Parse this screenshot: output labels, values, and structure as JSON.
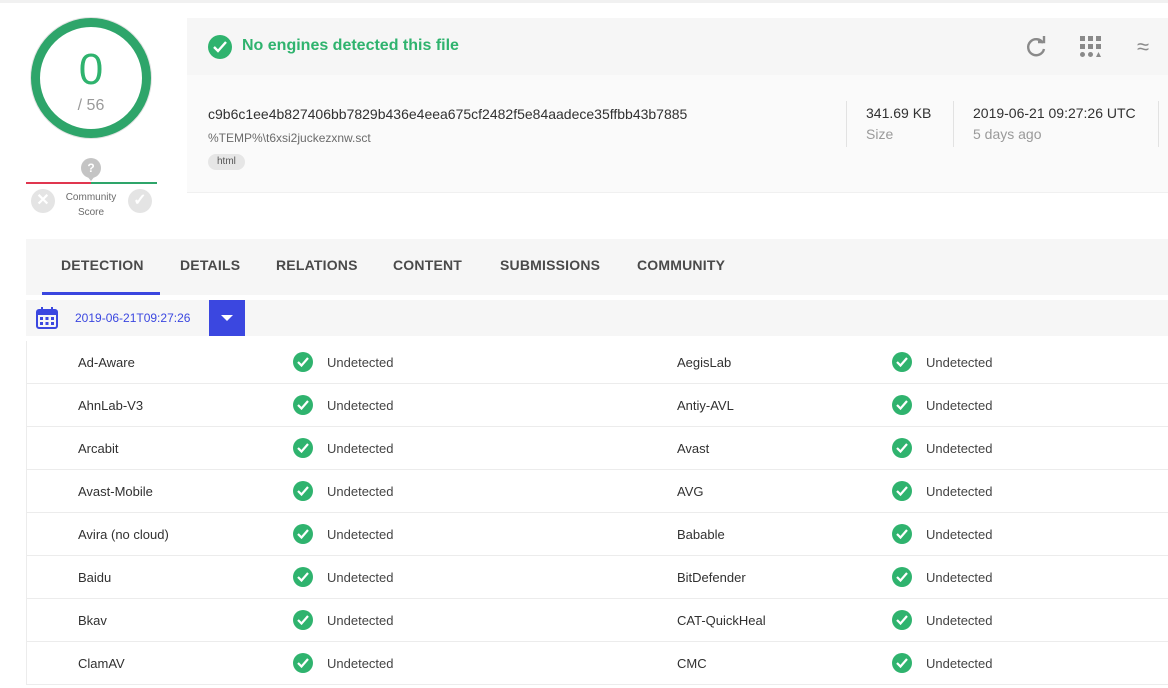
{
  "score": {
    "detections": "0",
    "total": "/ 56"
  },
  "community": {
    "marker": "?",
    "label_line1": "Community",
    "label_line2": "Score"
  },
  "summary": {
    "status_text": "No engines detected this file",
    "hash": "c9b6c1ee4b827406bb7829b436e4eea675cf2482f5e84aadece35ffbb43b7885",
    "filename": "%TEMP%\\t6xsi2juckezxnw.sct",
    "tag": "html",
    "size_value": "341.69 KB",
    "size_label": "Size",
    "date_value": "2019-06-21 09:27:26 UTC",
    "date_ago": "5 days ago",
    "wave_glyph": "≈"
  },
  "tabs": [
    "DETECTION",
    "DETAILS",
    "RELATIONS",
    "CONTENT",
    "SUBMISSIONS",
    "COMMUNITY"
  ],
  "analysis_date": "2019-06-21T09:27:26",
  "results": [
    {
      "a_engine": "Ad-Aware",
      "a_result": "Undetected",
      "b_engine": "AegisLab",
      "b_result": "Undetected"
    },
    {
      "a_engine": "AhnLab-V3",
      "a_result": "Undetected",
      "b_engine": "Antiy-AVL",
      "b_result": "Undetected"
    },
    {
      "a_engine": "Arcabit",
      "a_result": "Undetected",
      "b_engine": "Avast",
      "b_result": "Undetected"
    },
    {
      "a_engine": "Avast-Mobile",
      "a_result": "Undetected",
      "b_engine": "AVG",
      "b_result": "Undetected"
    },
    {
      "a_engine": "Avira (no cloud)",
      "a_result": "Undetected",
      "b_engine": "Babable",
      "b_result": "Undetected"
    },
    {
      "a_engine": "Baidu",
      "a_result": "Undetected",
      "b_engine": "BitDefender",
      "b_result": "Undetected"
    },
    {
      "a_engine": "Bkav",
      "a_result": "Undetected",
      "b_engine": "CAT-QuickHeal",
      "b_result": "Undetected"
    },
    {
      "a_engine": "ClamAV",
      "a_result": "Undetected",
      "b_engine": "CMC",
      "b_result": "Undetected"
    }
  ],
  "colors": {
    "accent": "#3b47e0",
    "clean": "#2fb36e",
    "ring": "#2ea56a",
    "malicious": "#e0364f"
  },
  "icons": [
    "check-circle-icon",
    "refresh-icon",
    "qr-grid-icon",
    "wave-icon",
    "calendar-icon",
    "chevron-down-icon",
    "x-icon",
    "check-icon",
    "question-icon"
  ]
}
